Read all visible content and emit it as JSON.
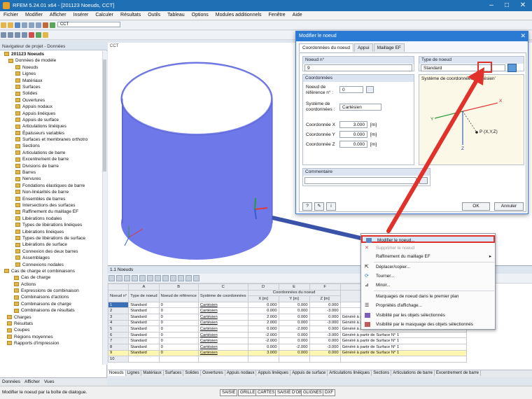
{
  "window": {
    "title": "RFEM 5.24.01 x64 - [201123 Noeuds, CCT]",
    "minimize": "–",
    "maximize": "□",
    "close": "✕"
  },
  "menu": [
    "Fichier",
    "Modifier",
    "Afficher",
    "Insérer",
    "Calculer",
    "Résultats",
    "Outils",
    "Tableau",
    "Options",
    "Modules additionnels",
    "Fenêtre",
    "Aide"
  ],
  "toolbar": {
    "load_case": "CCT"
  },
  "navigator": {
    "title": "Navigateur de projet - Données",
    "items": [
      "201123 Noeuds",
      "Données de modèle",
      "Noeuds",
      "Lignes",
      "Matériaux",
      "Surfaces",
      "Solides",
      "Ouvertures",
      "Appuis nodaux",
      "Appuis linéiques",
      "Appuis de surface",
      "Articulations linéiques",
      "Épaisseurs variables",
      "Surfaces et membranes orthotro",
      "Sections",
      "Articulations de barre",
      "Excentrement de barre",
      "Divisions de barre",
      "Barres",
      "Nervures",
      "Fondations élastiques de barre",
      "Non-linéarités de barre",
      "Ensembles de barres",
      "Intersections des surfaces",
      "Raffinement du maillage EF",
      "Libérations nodales",
      "Types de libérations linéiques",
      "Libérations linéiques",
      "Types de libérations de surface",
      "Libérations de surface",
      "Connexion des deux barres",
      "Assemblages",
      "Connexions nodales",
      "Cas de charge et combinaisons",
      "Cas de charge",
      "Actions",
      "Expressions de combinaison",
      "Combinaisons d'actions",
      "Combinaisons de charge",
      "Combinaisons de résultats",
      "Charges",
      "Résultats",
      "Coupes",
      "Régions moyennes",
      "Rapports d'impression"
    ],
    "tabs": [
      "Données",
      "Afficher",
      "Vues"
    ]
  },
  "viewport": {
    "label": "CCT"
  },
  "table": {
    "title": "1.1 Noeuds",
    "col_letters": [
      "A",
      "B",
      "C",
      "D",
      "E",
      "F"
    ],
    "headers": [
      "Noeud n°",
      "Type de noeud",
      "Noeud de référence",
      "Système de coordonnées",
      "Coordonnées du noeud",
      "X [m]",
      "Y [m]",
      "Z [m]",
      "Commentaire"
    ],
    "rows": [
      [
        "1",
        "Standard",
        "0",
        "Cartésien",
        "0.000",
        "0.000",
        "0.000",
        ""
      ],
      [
        "2",
        "Standard",
        "0",
        "Cartésien",
        "0.000",
        "0.000",
        "-3.000",
        ""
      ],
      [
        "3",
        "Standard",
        "0",
        "Cartésien",
        "2.000",
        "0.000",
        "0.000",
        "Généré à partir de Surface N° 1"
      ],
      [
        "4",
        "Standard",
        "0",
        "Cartésien",
        "2.000",
        "0.000",
        "-3.000",
        "Généré à partir de Surface N° 1"
      ],
      [
        "5",
        "Standard",
        "0",
        "Cartésien",
        "0.000",
        "-2.000",
        "0.000",
        "Généré à partir de Surface N° 1"
      ],
      [
        "6",
        "Standard",
        "0",
        "Cartésien",
        "-2.000",
        "0.000",
        "-3.000",
        "Généré à partir de Surface N° 1"
      ],
      [
        "7",
        "Standard",
        "0",
        "Cartésien",
        "-2.000",
        "0.000",
        "0.000",
        "Généré à partir de Surface N° 1"
      ],
      [
        "8",
        "Standard",
        "0",
        "Cartésien",
        "0.000",
        "-2.000",
        "-3.000",
        "Généré à partir de Surface N° 1"
      ],
      [
        "9",
        "Standard",
        "0",
        "Cartésien",
        "3.000",
        "0.000",
        "0.000",
        "Généré à partir de Surface N° 1"
      ],
      [
        "10",
        "",
        "",
        "",
        "",
        "",
        "",
        ""
      ]
    ],
    "sheets": [
      "Noeuds",
      "Lignes",
      "Matériaux",
      "Surfaces",
      "Solides",
      "Ouvertures",
      "Appuis nodaux",
      "Appuis linéiques",
      "Appuis de surface",
      "Articulations linéiques",
      "Sections",
      "Articulations de barre",
      "Excentrement de barre"
    ]
  },
  "dialog": {
    "title": "Modifier le noeud",
    "tabs": [
      "Coordonnées du noeud",
      "Appui",
      "Maillage EF"
    ],
    "node_no_label": "Noeud n°",
    "node_no": "9",
    "type_label": "Type de noeud",
    "type_value": "Standard",
    "coords_label": "Coordonnées",
    "ref_label": "Noeud de référence n° :",
    "ref_value": "0",
    "sys_label": "Système de coordonnées :",
    "sys_value": "Cartésien",
    "x_label": "Coordonnée X",
    "x_value": "3.000",
    "y_label": "Coordonnée Y",
    "y_value": "0.000",
    "z_label": "Coordonnée Z",
    "z_value": "0.000",
    "unit": "[m]",
    "cs_label": "Système de coordonnées 'Cartésien'",
    "axis_x": "X",
    "axis_y": "Y",
    "axis_z": "Z",
    "point_label": "P (X,Y,Z)",
    "comment_label": "Commentaire",
    "ok": "OK",
    "cancel": "Annuler"
  },
  "context_menu": [
    "Modifier le noeud...",
    "Supprimer le noeud",
    "Raffinement du maillage EF",
    "Déplacer/copier...",
    "Tourner...",
    "Miroir...",
    "Marquages de noeud dans le premier plan",
    "Propriétés d'affichage...",
    "Visibilité par les objets sélectionnés",
    "Visibilité par le masquage des objets sélectionnés"
  ],
  "status": {
    "text": "Modifier le noeud par la boîte de dialogue.",
    "toggles": [
      "SAISIE",
      "GRILLE",
      "CARTES",
      "SAISIE D'OB.",
      "GLIGNES",
      "DXF"
    ]
  },
  "colors": {
    "title": "#1f6fb5",
    "dialog_title": "#2a7ad4",
    "cylinder": "#6f78e8",
    "arrow": "#e0322b"
  }
}
